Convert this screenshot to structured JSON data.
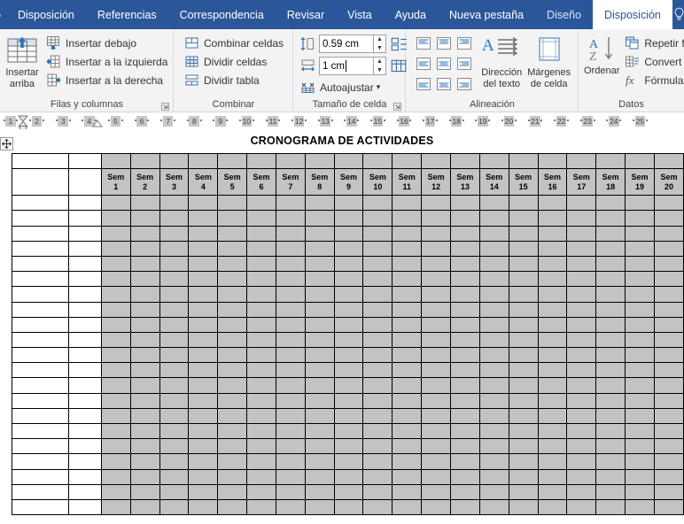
{
  "window": {
    "app": "Microsoft Word",
    "ribbon_tabs": [
      {
        "label": "o",
        "state": "clipped"
      },
      {
        "label": "Disposición",
        "state": "normal"
      },
      {
        "label": "Referencias",
        "state": "normal"
      },
      {
        "label": "Correspondencia",
        "state": "normal"
      },
      {
        "label": "Revisar",
        "state": "normal"
      },
      {
        "label": "Vista",
        "state": "normal"
      },
      {
        "label": "Ayuda",
        "state": "normal"
      },
      {
        "label": "Nueva pestaña",
        "state": "normal"
      },
      {
        "label": "Diseño",
        "state": "contextual"
      },
      {
        "label": "Disposición",
        "state": "active"
      }
    ],
    "tell_me_icon": "lightbulb-icon"
  },
  "ribbon": {
    "groups": {
      "rows_columns": {
        "label": "Filas y columnas",
        "dialog_launcher": "dialog-launcher-icon",
        "big_button": {
          "label_line1": "Insertar",
          "label_line2": "arriba",
          "icon": "insert-rows-above-icon"
        },
        "buttons": [
          {
            "label": "Insertar debajo",
            "icon": "insert-rows-below-icon"
          },
          {
            "label": "Insertar a la izquierda",
            "icon": "insert-columns-left-icon"
          },
          {
            "label": "Insertar a la derecha",
            "icon": "insert-columns-right-icon"
          }
        ]
      },
      "merge": {
        "label": "Combinar",
        "buttons": [
          {
            "label": "Combinar celdas",
            "icon": "merge-cells-icon"
          },
          {
            "label": "Dividir celdas",
            "icon": "split-cells-icon"
          },
          {
            "label": "Dividir tabla",
            "icon": "split-table-icon"
          }
        ]
      },
      "cell_size": {
        "label": "Tamaño de celda",
        "dialog_launcher": "dialog-launcher-icon",
        "height_field": {
          "icon": "row-height-icon",
          "value": "0.59 cm",
          "side_icon": "distribute-rows-icon"
        },
        "width_field": {
          "icon": "column-width-icon",
          "value": "1 cm",
          "has_caret": true,
          "side_icon": "distribute-columns-icon"
        },
        "autofit": {
          "label": "Autoajustar",
          "icon": "autofit-icon",
          "dropdown": "▾"
        }
      },
      "alignment": {
        "label": "Alineación",
        "buttons": [
          {
            "name": "align-top-left",
            "icon": "align-top-left-icon"
          },
          {
            "name": "align-top-center",
            "icon": "align-top-center-icon"
          },
          {
            "name": "align-top-right",
            "icon": "align-top-right-icon"
          },
          {
            "name": "align-middle-left",
            "icon": "align-middle-left-icon"
          },
          {
            "name": "align-middle-center",
            "icon": "align-middle-center-icon"
          },
          {
            "name": "align-middle-right",
            "icon": "align-middle-right-icon"
          },
          {
            "name": "align-bottom-left",
            "icon": "align-bottom-left-icon"
          },
          {
            "name": "align-bottom-center",
            "icon": "align-bottom-center-icon"
          },
          {
            "name": "align-bottom-right",
            "icon": "align-bottom-right-icon"
          }
        ],
        "text_direction": {
          "label_line1": "Dirección",
          "label_line2": "del texto",
          "icon": "text-direction-icon"
        },
        "cell_margins": {
          "label_line1": "Márgenes",
          "label_line2": "de celda",
          "icon": "cell-margins-icon"
        }
      },
      "data": {
        "label": "Datos",
        "sort": {
          "label": "Ordenar",
          "icon": "sort-az-icon"
        },
        "buttons": [
          {
            "label": "Repetir f",
            "icon": "repeat-header-rows-icon"
          },
          {
            "label": "Convert",
            "icon": "convert-to-text-icon"
          },
          {
            "label": "Fórmula",
            "icon": "formula-fx-icon"
          }
        ]
      }
    }
  },
  "ruler": {
    "numbers": [
      "1",
      "2",
      "3",
      "4",
      "5",
      "6",
      "7",
      "8",
      "9",
      "10",
      "11",
      "12",
      "13",
      "14",
      "15",
      "16",
      "17",
      "18",
      "19",
      "20",
      "21",
      "22",
      "23",
      "24",
      "25"
    ]
  },
  "document": {
    "move_handle_icon": "table-move-handle-icon",
    "title": "CRONOGRAMA DE ACTIVIDADES",
    "table": {
      "blank_columns": 2,
      "week_headers": [
        "Sem\n1",
        "Sem\n2",
        "Sem\n3",
        "Sem\n4",
        "Sem\n5",
        "Sem\n6",
        "Sem\n7",
        "Sem\n8",
        "Sem\n9",
        "Sem\n10",
        "Sem\n11",
        "Sem\n12",
        "Sem\n13",
        "Sem\n14",
        "Sem\n15",
        "Sem\n16",
        "Sem\n17",
        "Sem\n18",
        "Sem\n19",
        "Sem\n20"
      ],
      "week_prefix": "Sem",
      "week_numbers": [
        "1",
        "2",
        "3",
        "4",
        "5",
        "6",
        "7",
        "8",
        "9",
        "10",
        "11",
        "12",
        "13",
        "14",
        "15",
        "16",
        "17",
        "18",
        "19",
        "20"
      ],
      "body_rows": 21,
      "body_cells_empty": true
    }
  },
  "colors": {
    "ribbon_accent": "#2b579a",
    "ribbon_background": "#f3f3f3",
    "table_shaded": "#c3c3c3",
    "table_border": "#000000",
    "ruler_segment": "#c6c6c6"
  }
}
